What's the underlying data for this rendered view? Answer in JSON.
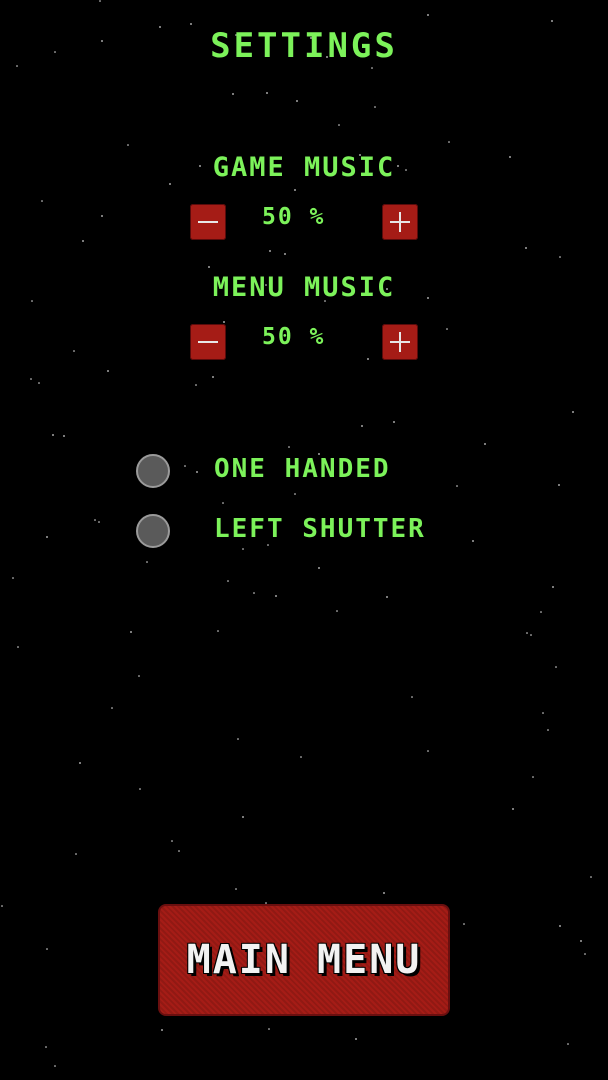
{
  "theme": {
    "green": "#7cf25a",
    "red": "#a51c16"
  },
  "screen": {
    "title": "SETTINGS"
  },
  "game_music": {
    "label": "GAME MUSIC",
    "value": "50 %",
    "level_percent": 50,
    "decrease_icon": "minus-icon",
    "increase_icon": "plus-icon"
  },
  "menu_music": {
    "label": "MENU MUSIC",
    "value": "50 %",
    "level_percent": 50,
    "decrease_icon": "minus-icon",
    "increase_icon": "plus-icon"
  },
  "options": [
    {
      "label": "ONE HANDED",
      "checked": false
    },
    {
      "label": "LEFT SHUTTER",
      "checked": false
    }
  ],
  "main_menu_button": {
    "label": "MAIN MENU"
  }
}
